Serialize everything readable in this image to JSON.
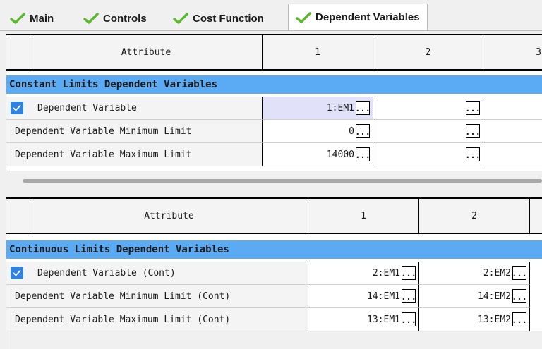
{
  "tabs": [
    {
      "label": "Main",
      "icon": "checkmark-icon"
    },
    {
      "label": "Controls",
      "icon": "checkmark-icon"
    },
    {
      "label": "Cost Function",
      "icon": "checkmark-icon"
    },
    {
      "label": "Dependent Variables",
      "icon": "checkmark-icon",
      "active": true
    }
  ],
  "colors": {
    "section_bg": "#5aaaf4",
    "checkmark": "#5cb82e",
    "checkbox": "#2f82e0",
    "selected_cell": "#e1e2fa"
  },
  "constant": {
    "headers": [
      "Attribute",
      "1",
      "2",
      "3"
    ],
    "section_title": "Constant Limits Dependent Variables",
    "rows": [
      {
        "label": "Dependent Variable",
        "checked": true,
        "values": [
          "1:EM1",
          ""
        ]
      },
      {
        "label": "Dependent Variable Minimum Limit",
        "values": [
          "0",
          ""
        ]
      },
      {
        "label": "Dependent Variable Maximum Limit",
        "values": [
          "14000",
          ""
        ]
      }
    ],
    "ellipsis": "..."
  },
  "continuous": {
    "headers": [
      "Attribute",
      "1",
      "2"
    ],
    "section_title": "Continuous Limits Dependent Variables",
    "rows": [
      {
        "label": "Dependent Variable (Cont)",
        "checked": true,
        "values": [
          "2:EM1",
          "2:EM2"
        ]
      },
      {
        "label": "Dependent Variable Minimum Limit (Cont)",
        "values": [
          "14:EM1",
          "14:EM2"
        ]
      },
      {
        "label": "Dependent Variable Maximum Limit (Cont)",
        "values": [
          "13:EM1",
          "13:EM2"
        ]
      }
    ],
    "ellipsis": "..."
  }
}
